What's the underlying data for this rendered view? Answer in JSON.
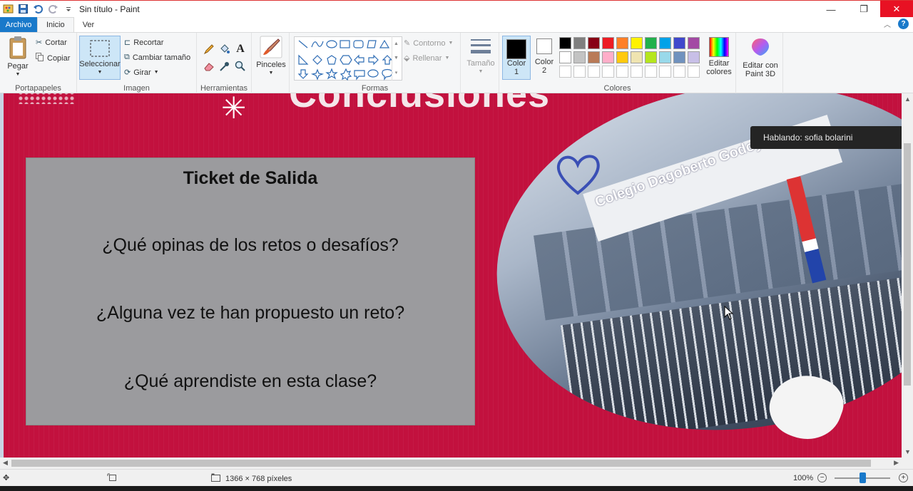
{
  "window": {
    "title": "Sin título - Paint",
    "minimize": "—",
    "maximize": "❐",
    "close": "✕"
  },
  "tabs": [
    {
      "label": "Archivo"
    },
    {
      "label": "Inicio"
    },
    {
      "label": "Ver"
    }
  ],
  "ribbon": {
    "clipboard": {
      "label": "Portapapeles",
      "paste": "Pegar",
      "cut": "Cortar",
      "copy": "Copiar"
    },
    "image": {
      "label": "Imagen",
      "select": "Seleccionar",
      "crop": "Recortar",
      "resize": "Cambiar tamaño",
      "rotate": "Girar"
    },
    "tools": {
      "label": "Herramientas"
    },
    "brushes": {
      "label": "Pinceles"
    },
    "shapes": {
      "label": "Formas",
      "outline": "Contorno",
      "fill": "Rellenar"
    },
    "size": {
      "label": "Tamaño"
    },
    "colors": {
      "label": "Colores",
      "color1": "Color 1",
      "color2": "Color 2",
      "edit_colors": "Editar colores",
      "paint3d": "Editar con Paint 3D",
      "row1": [
        "#000000",
        "#7f7f7f",
        "#880015",
        "#ed1c24",
        "#ff7f27",
        "#fff200",
        "#22b14c",
        "#00a2e8",
        "#3f48cc",
        "#a349a4"
      ],
      "row2": [
        "#ffffff",
        "#c3c3c3",
        "#b97a57",
        "#ffaec9",
        "#ffc90e",
        "#efe4b0",
        "#b5e61d",
        "#99d9ea",
        "#7092be",
        "#c8bfe7"
      ]
    }
  },
  "canvas": {
    "heading_partial": "Conclusiones",
    "ticket_title": "Ticket de Salida",
    "questions": [
      "¿Qué opinas de los retos o desafíos?",
      "¿Alguna vez te han propuesto un reto?",
      "¿Qué aprendiste en esta clase?"
    ],
    "sign_text": "Colegio Dagoberto Godoy",
    "tooltip": "Hablando: sofia bolarini",
    "accent_color": "#c2113e"
  },
  "status": {
    "dimensions": "1366 × 768 píxeles",
    "zoom": "100%"
  }
}
